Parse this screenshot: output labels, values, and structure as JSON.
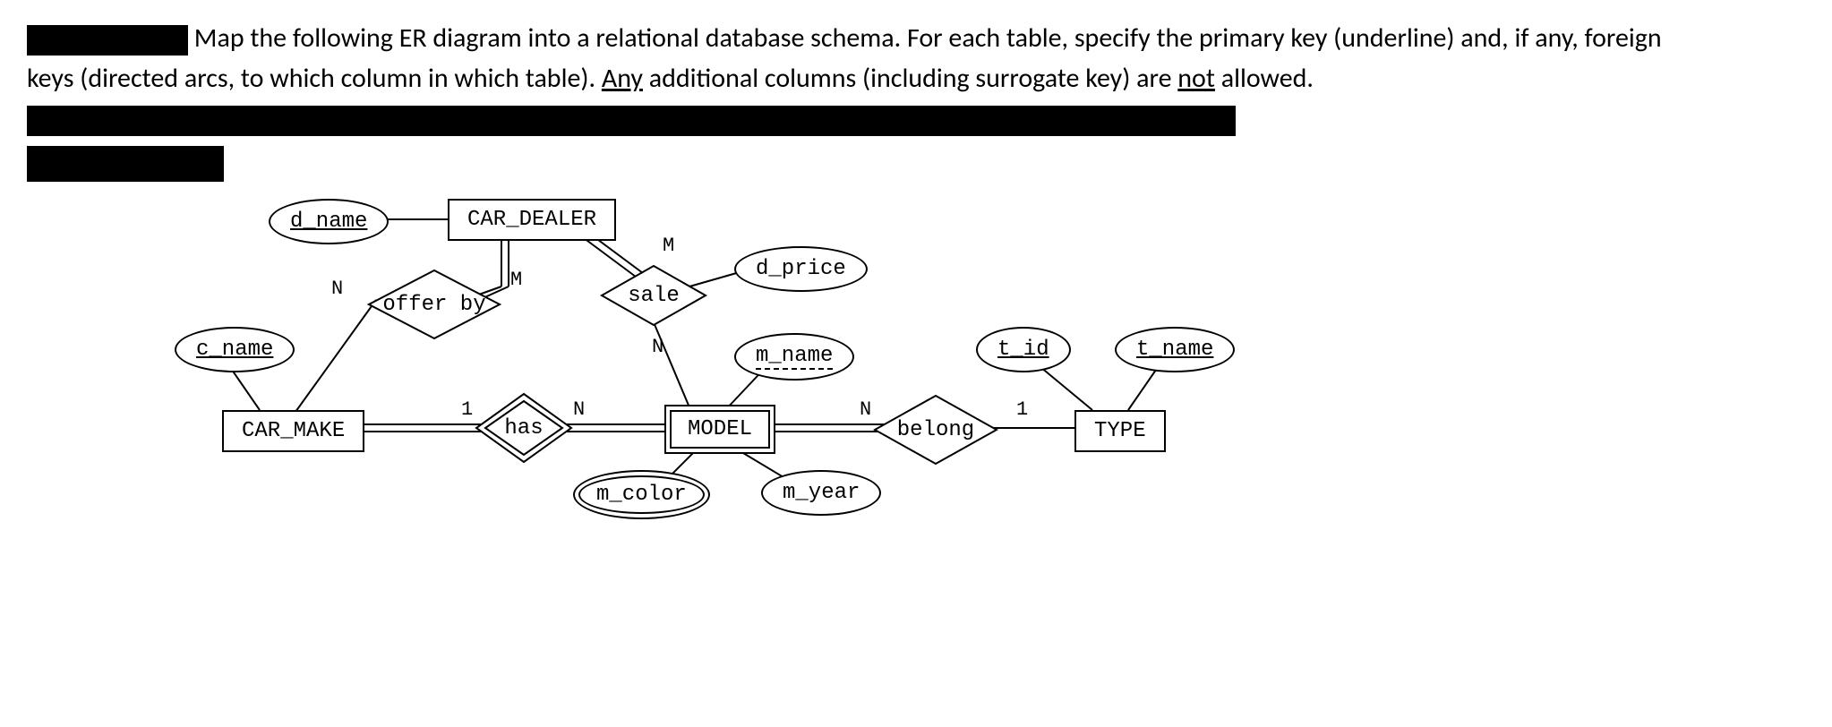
{
  "instruction": {
    "text1": "Map the following ER diagram into a relational database schema.  For each table, specify the primary key (underline) and, if any, foreign keys (directed arcs, to which column in which table).  ",
    "any": "Any",
    "text2": " additional columns (including surrogate key) are ",
    "not": "not",
    "text3": " allowed. "
  },
  "entities": {
    "car_dealer": "CAR_DEALER",
    "car_make": "CAR_MAKE",
    "model": "MODEL",
    "type": "TYPE"
  },
  "attributes": {
    "d_name": "d_name",
    "c_name": "c_name",
    "d_price": "d_price",
    "m_name": "m_name",
    "m_color": "m_color",
    "m_year": "m_year",
    "t_id": "t_id",
    "t_name": "t_name"
  },
  "relationships": {
    "offer_by": "offer by",
    "sale": "sale",
    "has": "has",
    "belong": "belong"
  },
  "cardinalities": {
    "offer_by_dealer": "M",
    "offer_by_make": "N",
    "sale_dealer": "M",
    "sale_model": "N",
    "has_make": "1",
    "has_model": "N",
    "belong_model": "N",
    "belong_type": "1"
  }
}
